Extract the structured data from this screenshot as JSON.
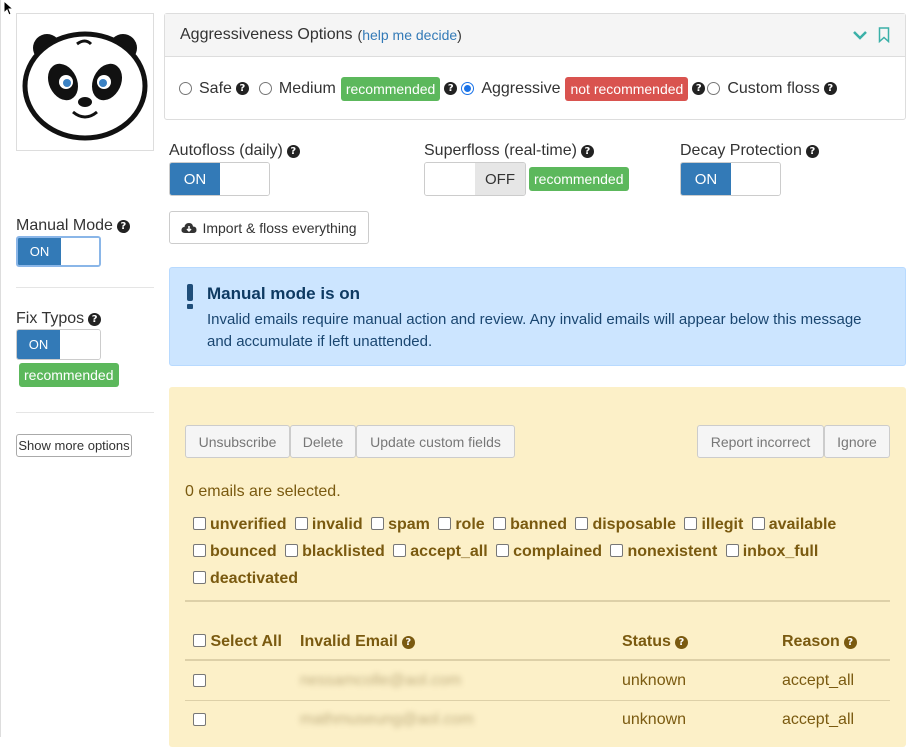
{
  "options_panel": {
    "title": "Aggressiveness Options",
    "help_link": "help me decide",
    "radios": [
      {
        "label": "Safe",
        "checked": false
      },
      {
        "label": "Medium",
        "badge": "recommended",
        "checked": false
      },
      {
        "label": "Aggressive",
        "badge": "not recommended",
        "checked": true
      },
      {
        "label": "Custom floss",
        "checked": false
      }
    ]
  },
  "toggles": {
    "autofloss": {
      "label": "Autofloss (daily)",
      "state": "ON"
    },
    "superfloss": {
      "label": "Superfloss (real-time)",
      "state": "OFF",
      "badge": "recommended"
    },
    "decay": {
      "label": "Decay Protection",
      "state": "ON"
    }
  },
  "import_button": "Import & floss everything",
  "sidebar": {
    "manual_mode": {
      "label": "Manual Mode",
      "state": "ON"
    },
    "fix_typos": {
      "label": "Fix Typos",
      "state": "ON",
      "badge": "recommended"
    },
    "show_more": "Show more options"
  },
  "alert": {
    "title": "Manual mode is on",
    "body": "Invalid emails require manual action and review. Any invalid emails will appear below this message and accumulate if left unattended."
  },
  "actions": {
    "unsubscribe": "Unsubscribe",
    "delete": "Delete",
    "update": "Update custom fields",
    "report": "Report incorrect",
    "ignore": "Ignore"
  },
  "selected_text": "0 emails are selected.",
  "filters": [
    "unverified",
    "invalid",
    "spam",
    "role",
    "banned",
    "disposable",
    "illegit",
    "available",
    "bounced",
    "blacklisted",
    "accept_all",
    "complained",
    "nonexistent",
    "inbox_full",
    "deactivated"
  ],
  "table": {
    "headers": {
      "select_all": "Select All",
      "email": "Invalid Email",
      "status": "Status",
      "reason": "Reason"
    },
    "rows": [
      {
        "email": "nessamcolle@aol.com",
        "status": "unknown",
        "reason": "accept_all"
      },
      {
        "email": "mathmuseung@aol.com",
        "status": "unknown",
        "reason": "accept_all"
      }
    ]
  },
  "colors": {
    "primary": "#337ab7",
    "success": "#5cb85c",
    "danger": "#d9534f",
    "alert_bg": "#cce5ff",
    "panel_bg": "#fcf0c8"
  }
}
